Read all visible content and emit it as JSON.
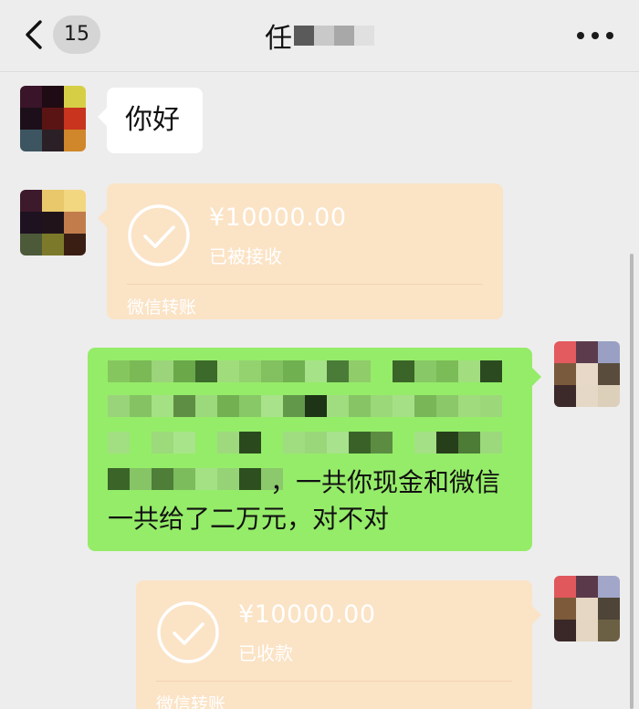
{
  "header": {
    "back_icon": "chevron-left-icon",
    "unread_count": "15",
    "title": "任",
    "more_icon": "more-dots-icon"
  },
  "messages": [
    {
      "type": "text",
      "direction": "incoming",
      "text": "你好"
    },
    {
      "type": "transfer",
      "direction": "incoming",
      "amount": "¥10000.00",
      "status": "已被接收",
      "service": "微信转账",
      "icon": "check-circle-icon"
    },
    {
      "type": "text",
      "direction": "outgoing",
      "redacted": true,
      "line_3_tail": "，一共你现金和微信",
      "line_4": "一共给了二万元，对不对"
    },
    {
      "type": "transfer",
      "direction": "outgoing",
      "amount": "¥10000.00",
      "status": "已收款",
      "service": "微信转账",
      "icon": "check-circle-icon"
    }
  ],
  "colors": {
    "background": "#ededed",
    "bubble_incoming": "#ffffff",
    "bubble_outgoing": "#95ec69",
    "transfer_card": "#fbe3c6",
    "transfer_text": "#ffffff"
  }
}
